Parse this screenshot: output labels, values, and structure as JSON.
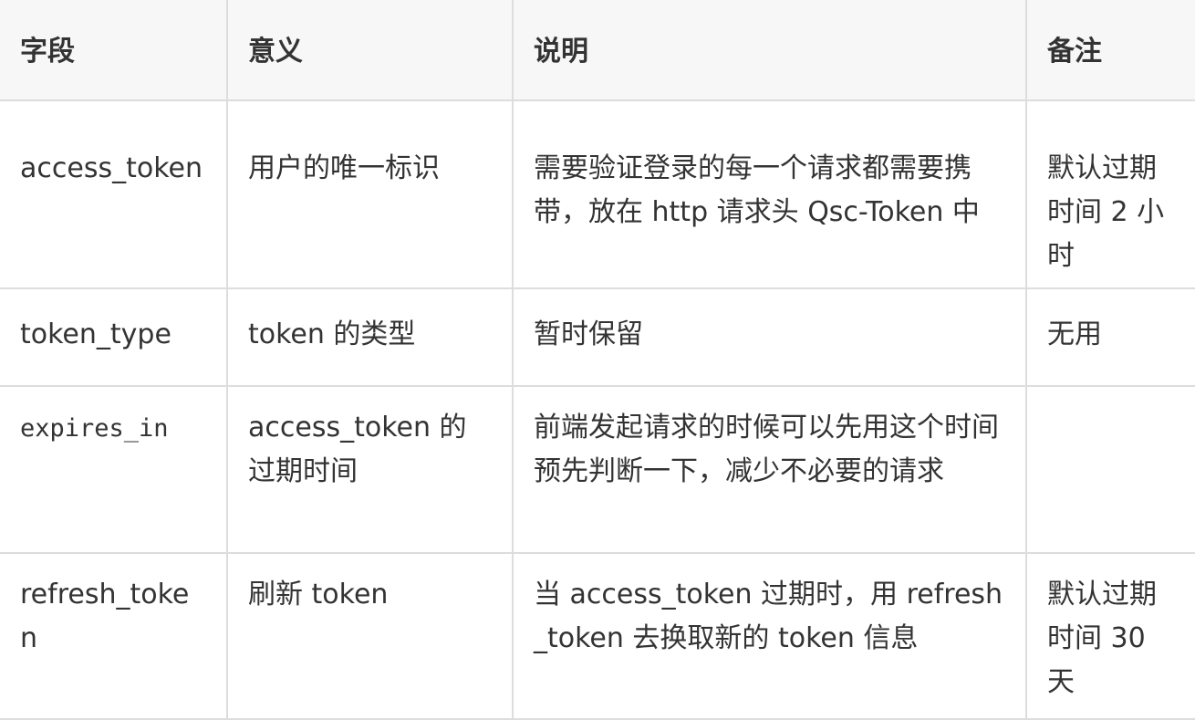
{
  "table": {
    "headers": [
      "字段",
      "意义",
      "说明",
      "备注"
    ],
    "rows": [
      {
        "field": "access_token",
        "meaning": "用户的唯一标识",
        "description": "需要验证登录的每一个请求都需要携带，放在 http 请求头 Qsc-Token 中",
        "note": "默认过期时间 2 小时"
      },
      {
        "field": "token_type",
        "meaning": "token 的类型",
        "description": "暂时保留",
        "note": "无用"
      },
      {
        "field": "expires_in",
        "meaning": "access_token 的过期时间",
        "description": "前端发起请求的时候可以先用这个时间预先判断一下，减少不必要的请求",
        "note": ""
      },
      {
        "field": "refresh_token",
        "meaning": "刷新 token",
        "description": "当 access_token 过期时，用 refresh_token 去换取新的 token 信息",
        "note": "默认过期时间 30 天"
      }
    ]
  }
}
